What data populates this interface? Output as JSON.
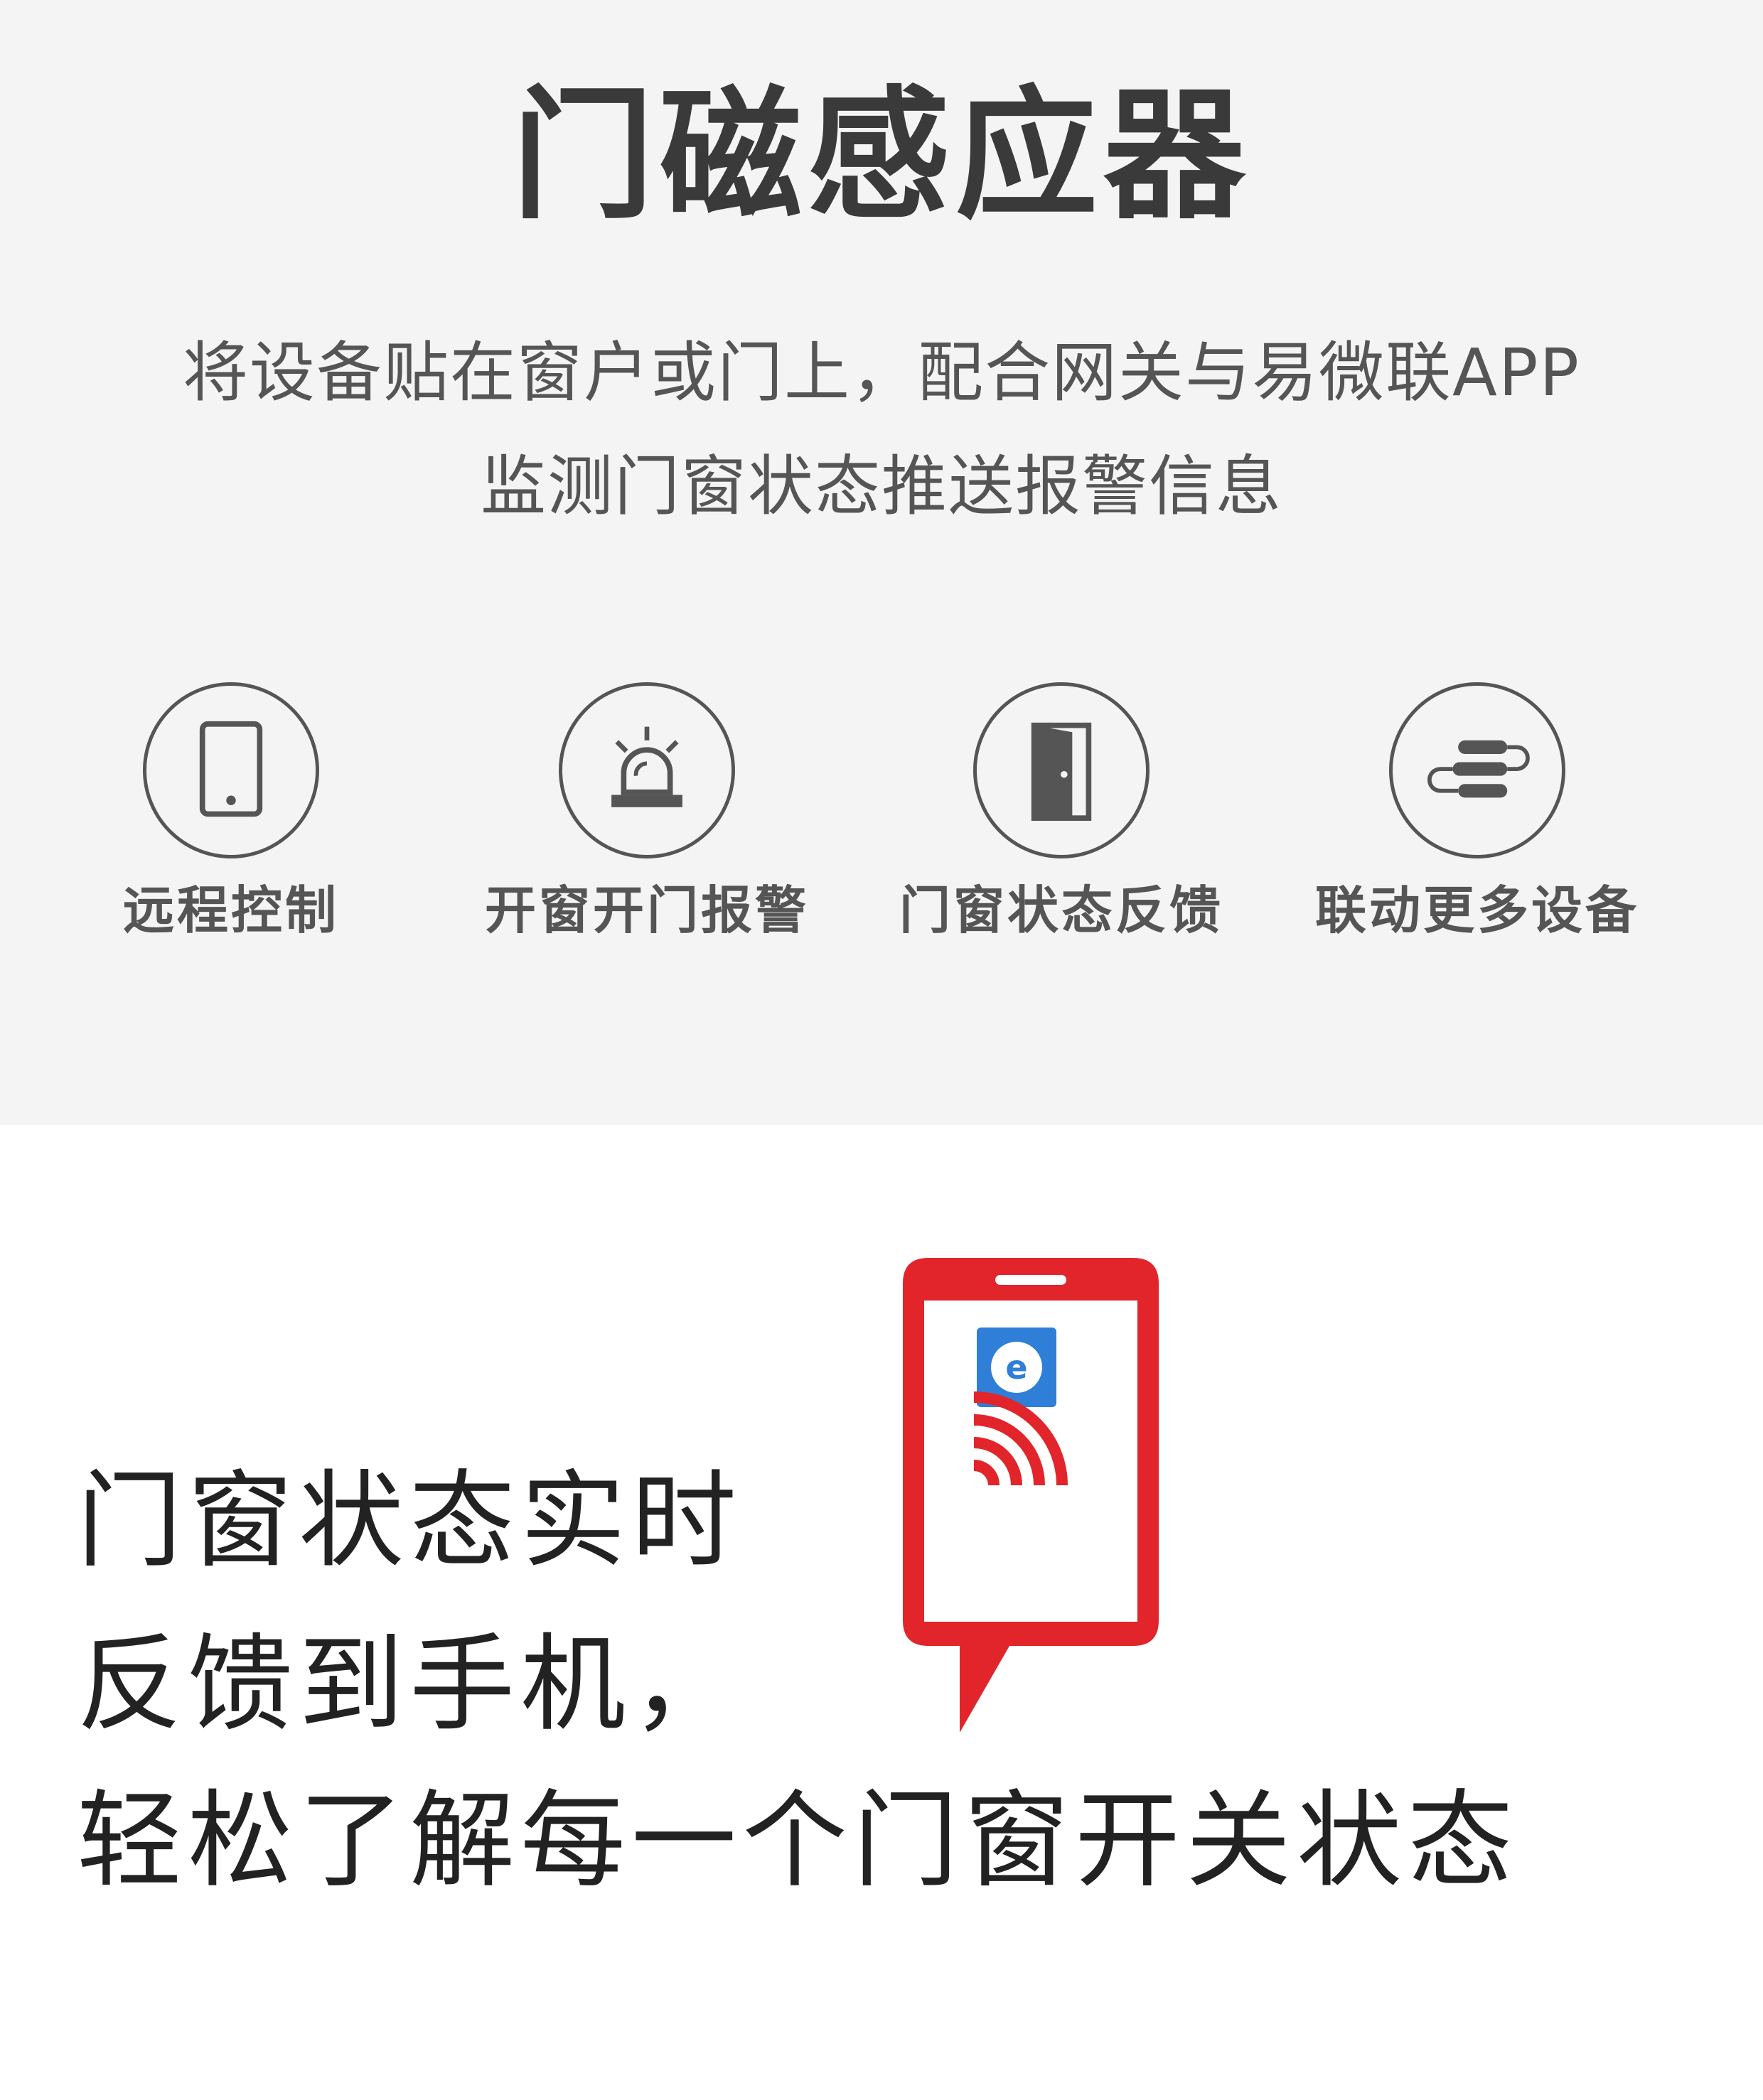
{
  "header": {
    "title": "门磁感应器",
    "subtitle_line1": "将设备贴在窗户或门上，配合网关与易微联APP",
    "subtitle_line2": "监测门窗状态推送报警信息"
  },
  "features": [
    {
      "label": "远程控制",
      "icon": "phone-icon"
    },
    {
      "label": "开窗开门报警",
      "icon": "alarm-light-icon"
    },
    {
      "label": "门窗状态反馈",
      "icon": "door-icon"
    },
    {
      "label": "联动更多设备",
      "icon": "link-icon"
    }
  ],
  "promo": {
    "line1": "门窗状态实时",
    "line2": "反馈到手机，",
    "line3": "轻松了解每一个门窗开关状态",
    "app_icon_letter": "e"
  },
  "colors": {
    "accent_red": "#e2252b",
    "app_blue": "#2f7ed8",
    "top_background": "#f4f4f4"
  }
}
